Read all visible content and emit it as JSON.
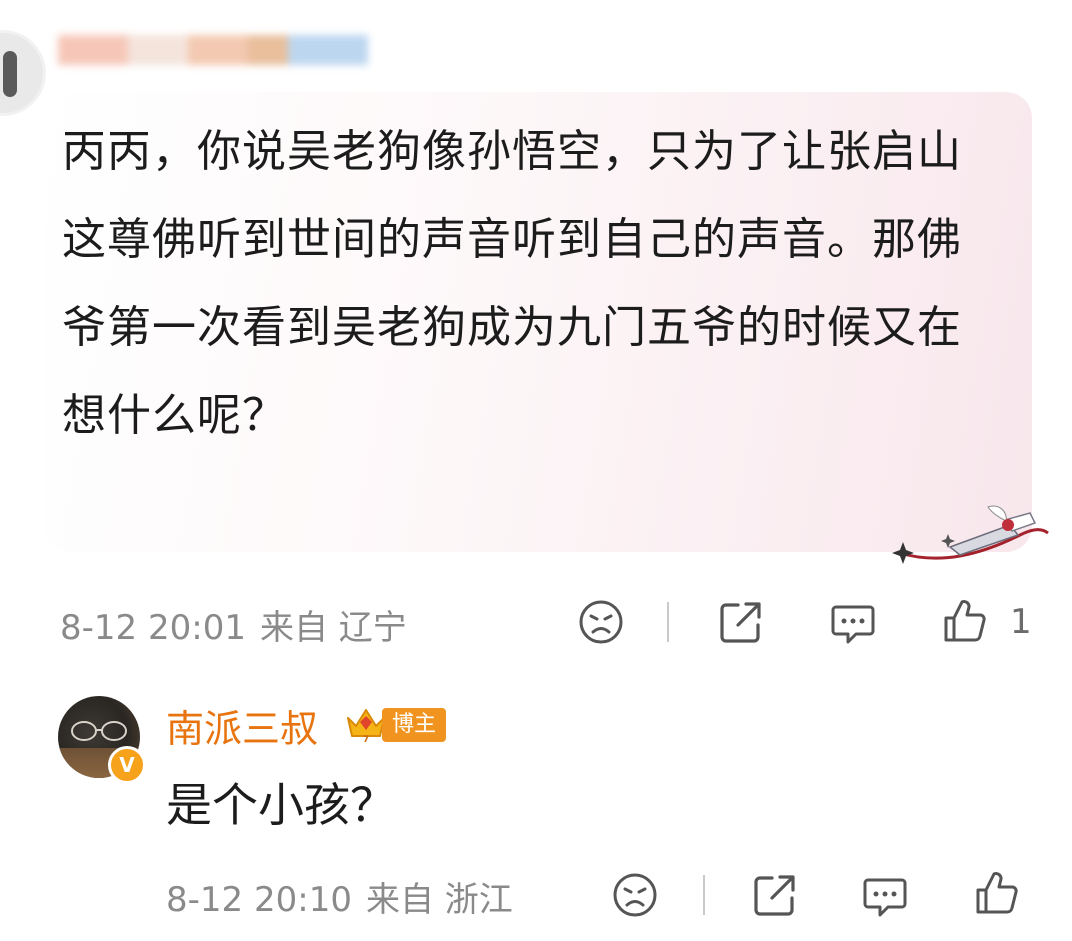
{
  "comment": {
    "text": "丙丙，你说吴老狗像孙悟空，只为了让张启山这尊佛听到世间的声音听到自己的声音。那佛爷第一次看到吴老狗成为九门五爷的时候又在想什么呢？",
    "timestamp": "8-12 20:01",
    "location": "来自 辽宁",
    "like_count": "1",
    "actions": [
      "dislike-icon",
      "share-icon",
      "comment-icon",
      "like-icon"
    ]
  },
  "reply": {
    "author": "南派三叔",
    "badge": "博主",
    "text": "是个小孩？",
    "timestamp": "8-12 20:10",
    "location": "来自 浙江",
    "verified_mark": "V"
  },
  "colors": {
    "accent_name": "#e8740f",
    "badge_bg": "#f0941f",
    "bubble_tint": "#f8e7ec",
    "meta_text": "#8a8a8a"
  }
}
